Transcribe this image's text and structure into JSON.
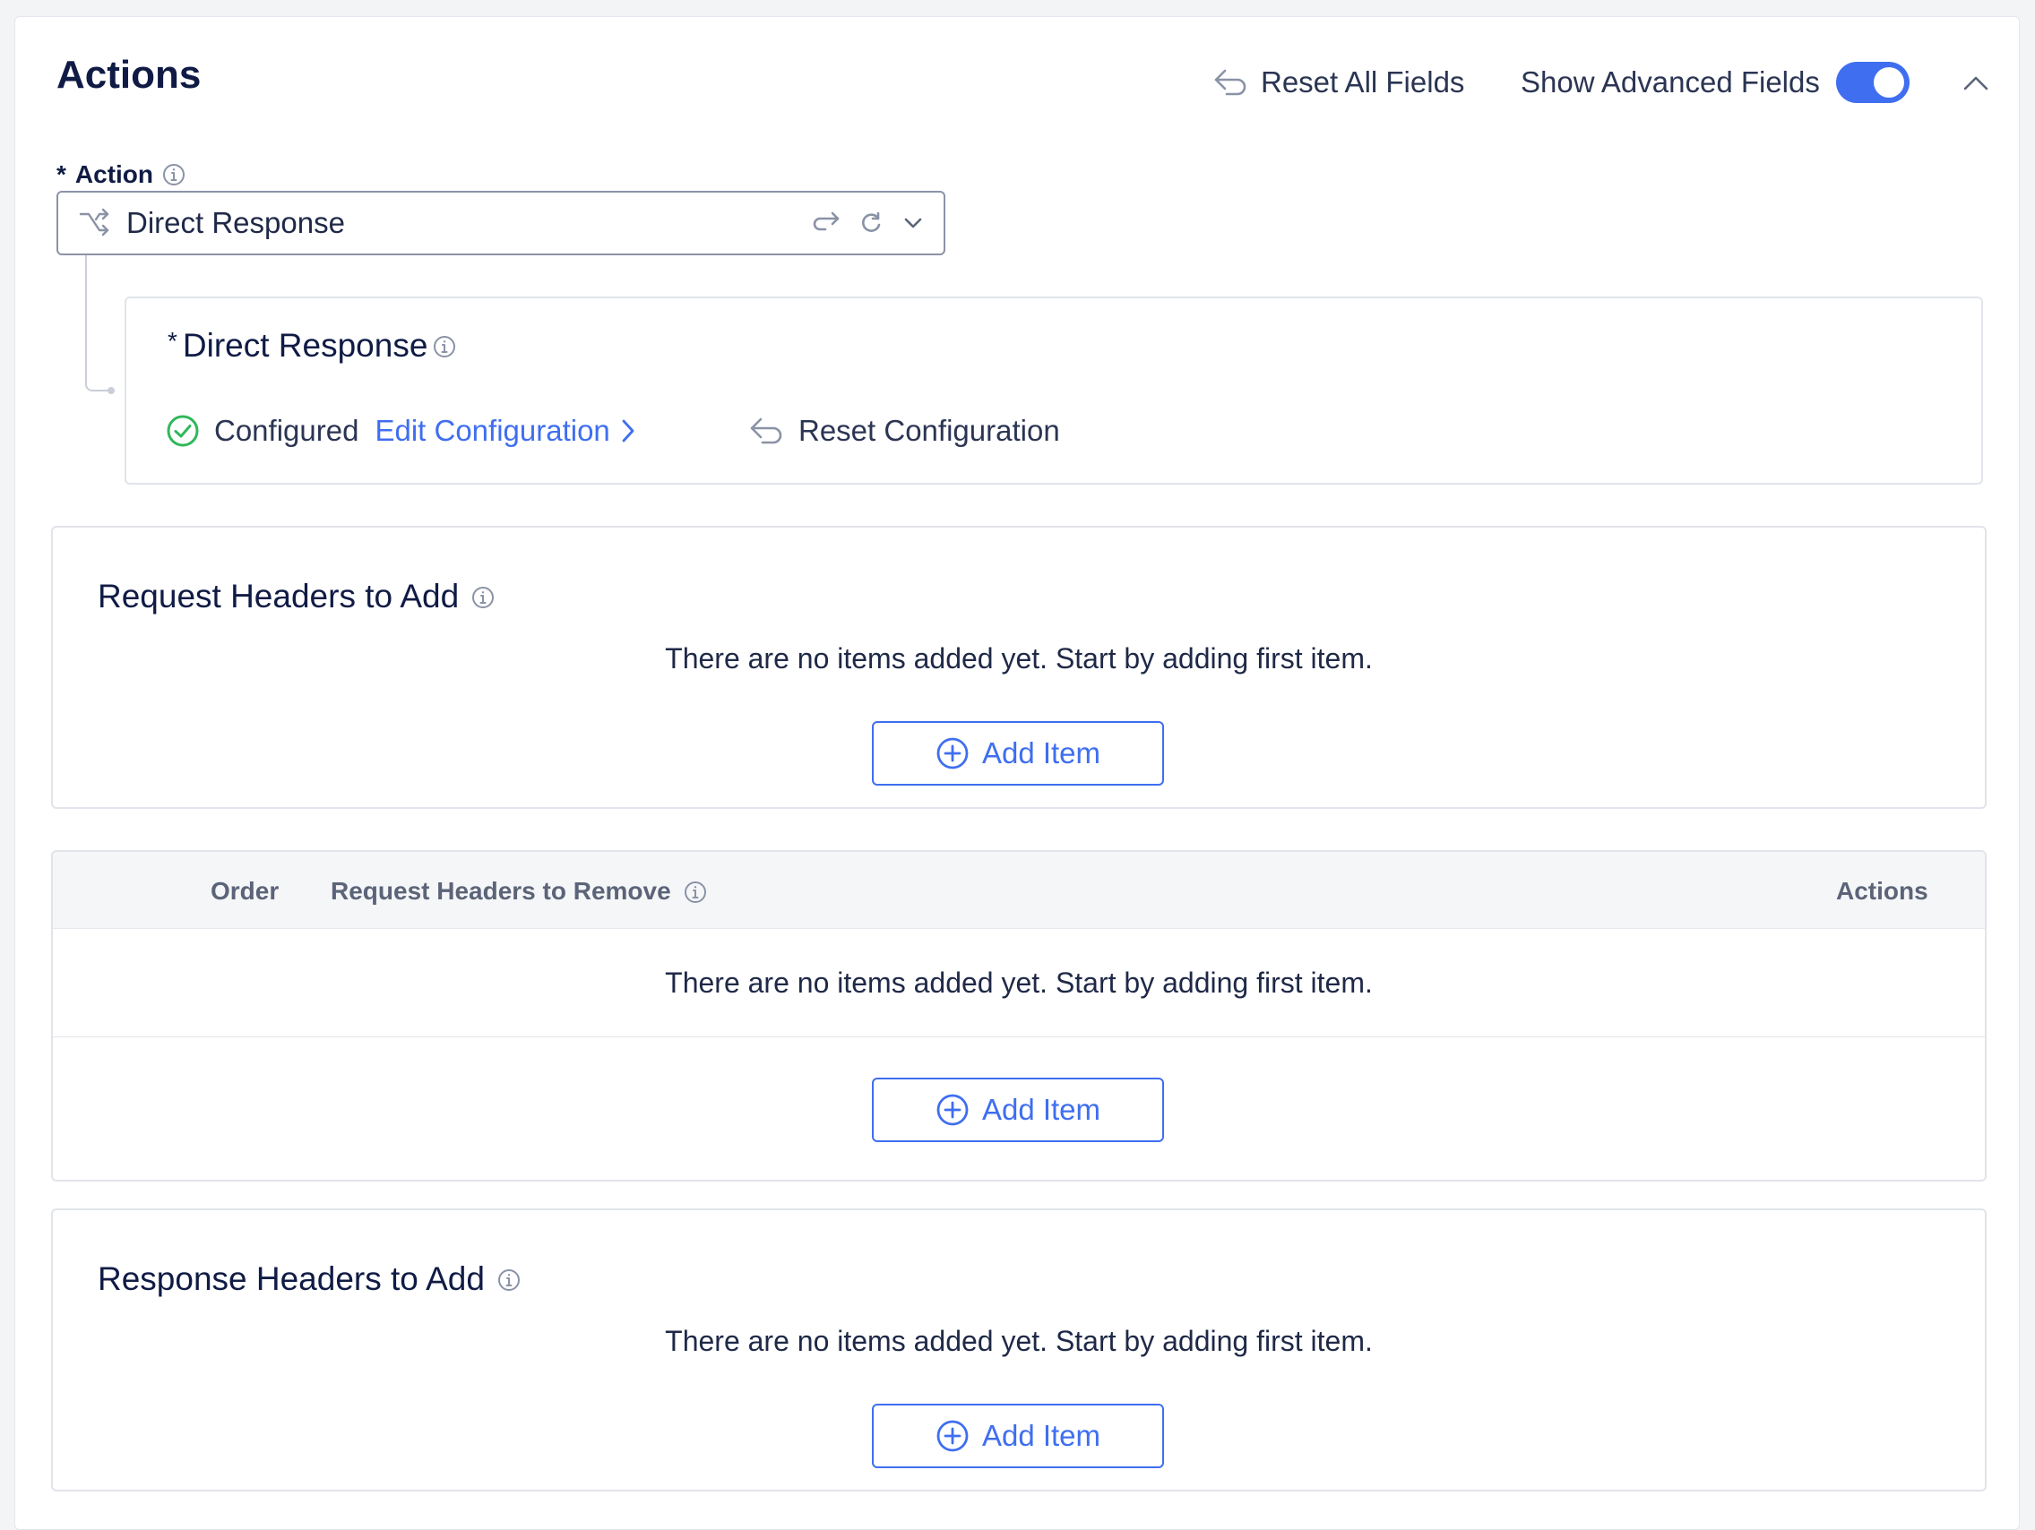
{
  "header": {
    "title": "Actions",
    "reset_all_label": "Reset All Fields",
    "show_advanced_label": "Show Advanced Fields",
    "show_advanced_enabled": true
  },
  "action_field": {
    "required_mark": "*",
    "label": "Action",
    "selected_value": "Direct Response"
  },
  "direct_response": {
    "required_mark": "*",
    "title": "Direct Response",
    "status": "Configured",
    "edit_label": "Edit Configuration",
    "reset_label": "Reset Configuration"
  },
  "request_headers_add": {
    "title": "Request Headers to Add",
    "empty_text": "There are no items added yet. Start by adding first item.",
    "add_label": "Add Item"
  },
  "request_headers_remove": {
    "columns": {
      "order": "Order",
      "name": "Request Headers to Remove",
      "actions": "Actions"
    },
    "empty_text": "There are no items added yet. Start by adding first item.",
    "add_label": "Add Item"
  },
  "response_headers_add": {
    "title": "Response Headers to Add",
    "empty_text": "There are no items added yet. Start by adding first item.",
    "add_label": "Add Item"
  },
  "colors": {
    "accent": "#3f6ef0",
    "success": "#2fb85a",
    "text": "#101b45",
    "border": "#e1e4ea"
  }
}
